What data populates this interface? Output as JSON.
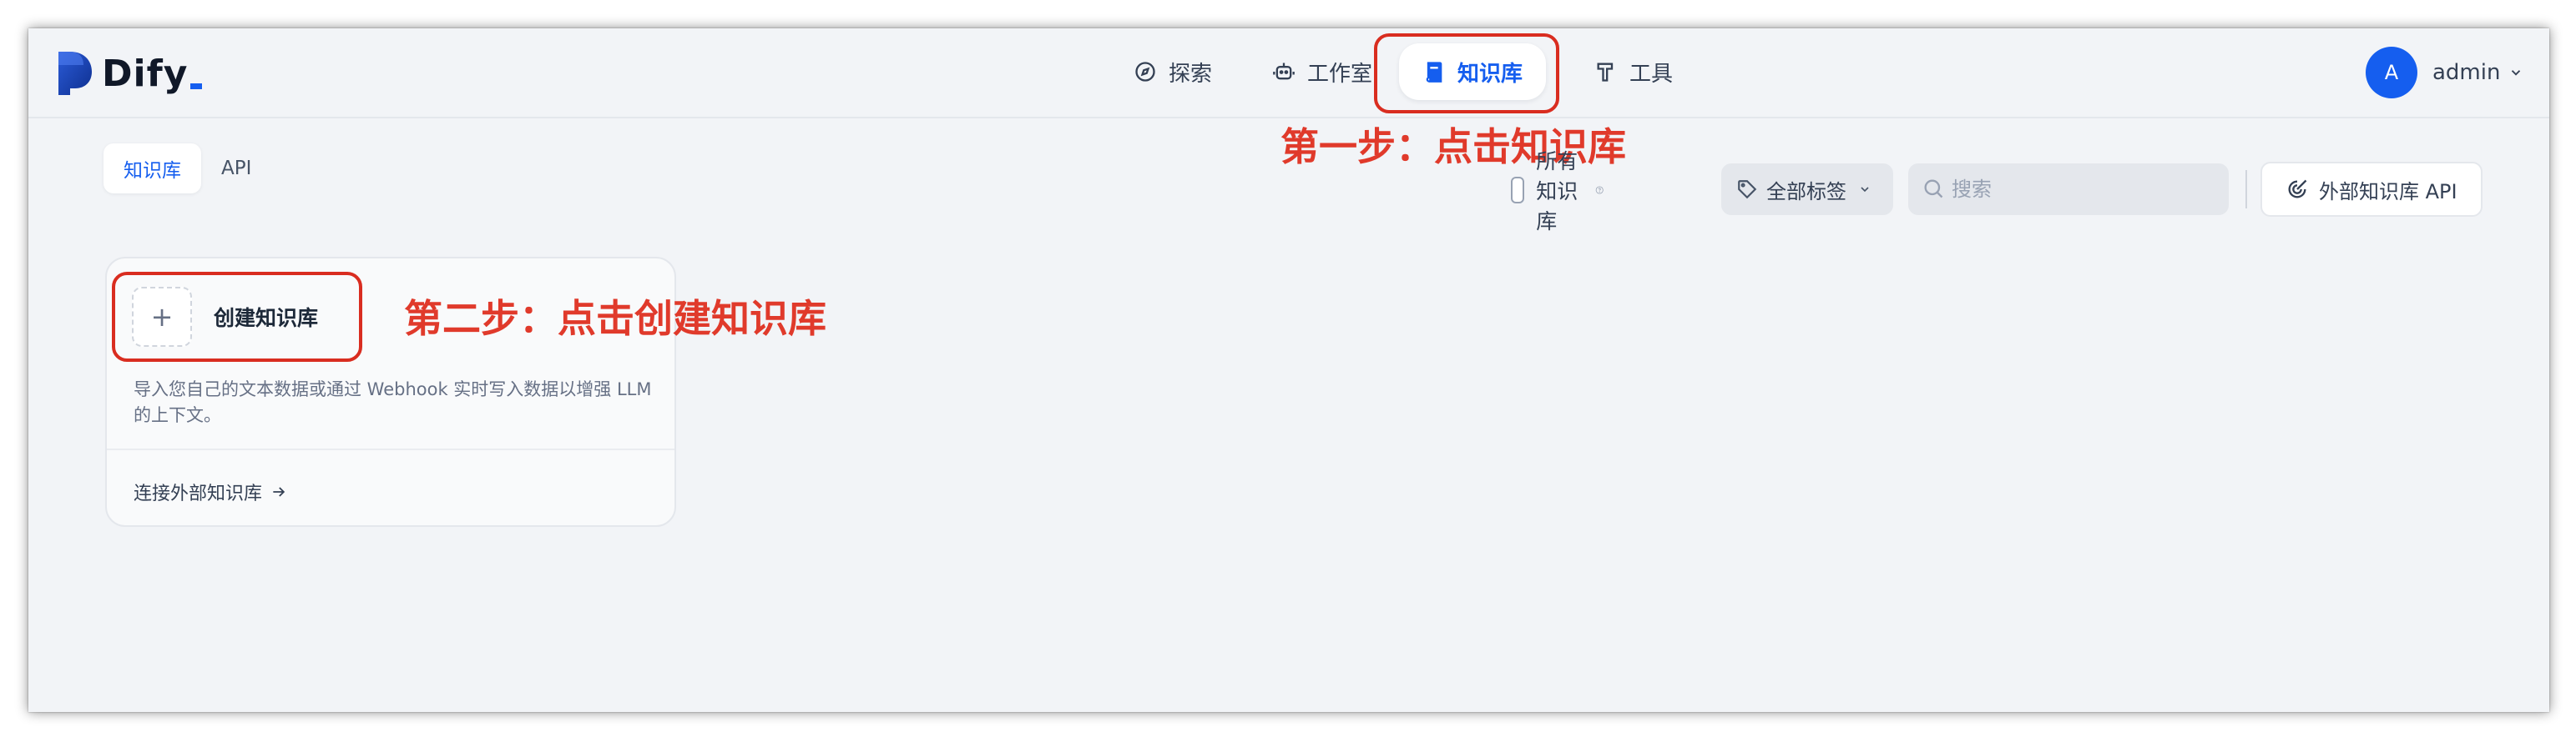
{
  "app": {
    "name": "Dify"
  },
  "nav": {
    "explore": "探索",
    "studio": "工作室",
    "knowledge": "知识库",
    "tools": "工具"
  },
  "user": {
    "initial": "A",
    "name": "admin"
  },
  "annotations": {
    "step1": "第一步：点击知识库",
    "step2": "第二步：点击创建知识库"
  },
  "tabs": [
    {
      "label": "知识库",
      "active": true
    },
    {
      "label": "API",
      "active": false
    }
  ],
  "toolbar": {
    "all_knowledge_label": "所有知识库",
    "all_knowledge_checked": false,
    "tag_filter_label": "全部标签",
    "search_placeholder": "搜索",
    "search_value": "",
    "external_api_label": "外部知识库 API"
  },
  "create_card": {
    "title": "创建知识库",
    "description": "导入您自己的文本数据或通过 Webhook 实时写入数据以增强 LLM 的上下文。",
    "connect_external": "连接外部知识库"
  },
  "colors": {
    "accent": "#155eef",
    "annotation": "#e03a2b",
    "background": "#f2f4f7"
  }
}
